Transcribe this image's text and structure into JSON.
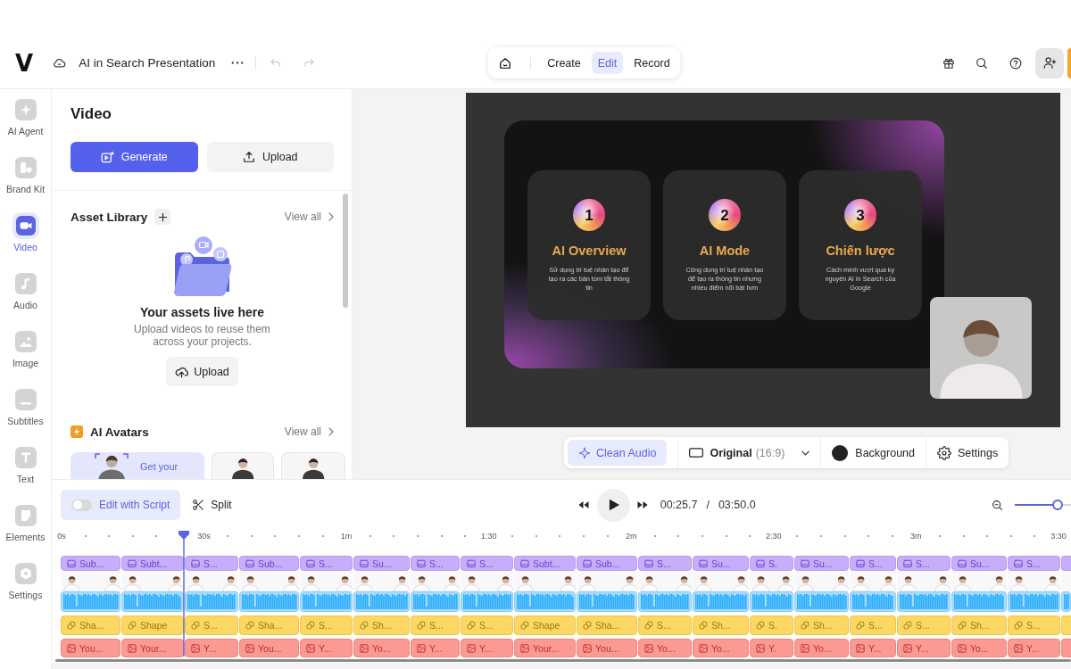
{
  "header": {
    "logo": "V",
    "project_title": "AI in Search Presentation",
    "undo": {
      "disabled": true
    },
    "redo": {
      "disabled": true
    },
    "modes": [
      {
        "label": "Create",
        "selected": false
      },
      {
        "label": "Edit",
        "selected": true
      },
      {
        "label": "Record",
        "selected": false
      }
    ]
  },
  "rail": {
    "items": [
      {
        "label": "AI Agent",
        "selected": false
      },
      {
        "label": "Brand Kit",
        "selected": false
      },
      {
        "label": "Video",
        "selected": true
      },
      {
        "label": "Audio",
        "selected": false
      },
      {
        "label": "Image",
        "selected": false
      },
      {
        "label": "Subtitles",
        "selected": false
      },
      {
        "label": "Text",
        "selected": false
      },
      {
        "label": "Elements",
        "selected": false
      },
      {
        "label": "Settings",
        "selected": false
      }
    ]
  },
  "panel": {
    "title": "Video",
    "actions": [
      {
        "label": "Generate",
        "kind": "primary"
      },
      {
        "label": "Upload",
        "kind": "secondary"
      }
    ],
    "asset_library": {
      "title": "Asset Library",
      "view_all": "View all",
      "empty_title": "Your assets live here",
      "empty_text": "Upload videos to reuse them across your projects.",
      "upload": "Upload"
    },
    "ai_avatars": {
      "title": "AI Avatars",
      "view_all": "View all",
      "cards": [
        {
          "kind": "create",
          "label": "Get your"
        },
        {
          "kind": "avatar"
        },
        {
          "kind": "avatar"
        }
      ]
    }
  },
  "preview": {
    "slide": {
      "cards": [
        {
          "number": "1",
          "title": "AI Overview",
          "text": "Sử dụng trí tuệ nhân tạo để tạo ra các bản tóm tắt thông tin"
        },
        {
          "number": "2",
          "title": "AI Mode",
          "text": "Cũng dùng trí tuệ nhân tạo để tạo ra thông tin nhưng nhiều điểm nổi bật hơn"
        },
        {
          "number": "3",
          "title": "Chiến lược",
          "text": "Cách mình vượt qua kỷ nguyên AI in Search của Google"
        }
      ]
    },
    "toolbar": {
      "clean_audio": {
        "label": "Clean Audio",
        "selected": true
      },
      "aspect": {
        "label": "Original",
        "ratio": "(16:9)"
      },
      "background": {
        "label": "Background"
      },
      "settings": {
        "label": "Settings"
      }
    }
  },
  "timeline": {
    "edit_with_script": {
      "label": "Edit with Script",
      "on": false
    },
    "split": "Split",
    "current_time": "00:25.7",
    "separator": "/",
    "total_time": "03:50.0",
    "zoom": {
      "level": 0.76
    },
    "playhead": {
      "level": 0.112
    },
    "ruler": [
      "0s",
      "30s",
      "1m",
      "1:30",
      "2m",
      "2:30",
      "3m",
      "3:30"
    ],
    "clips": [
      {
        "kind": "clip",
        "subtitle": "Sub...",
        "shape": "Sha...",
        "image": "You..."
      },
      {
        "kind": "clip",
        "subtitle": "Subt...",
        "shape": "Shape",
        "image": "Your..."
      },
      {
        "kind": "clip",
        "subtitle": "S...",
        "shape": "S...",
        "image": "Y..."
      },
      {
        "kind": "clip",
        "subtitle": "Sub...",
        "shape": "Sha...",
        "image": "You..."
      },
      {
        "kind": "clip",
        "subtitle": "S...",
        "shape": "S...",
        "image": "Y..."
      },
      {
        "kind": "clip",
        "subtitle": "Su...",
        "shape": "Sh...",
        "image": "Yo..."
      },
      {
        "kind": "clip",
        "subtitle": "S...",
        "shape": "S...",
        "image": "Y..."
      },
      {
        "kind": "clip",
        "subtitle": "S...",
        "shape": "S...",
        "image": "Y..."
      },
      {
        "kind": "clip",
        "subtitle": "Subt...",
        "shape": "Shape",
        "image": "Your..."
      },
      {
        "kind": "clip",
        "subtitle": "Sub...",
        "shape": "Sha...",
        "image": "You..."
      },
      {
        "kind": "clip",
        "subtitle": "S...",
        "shape": "S...",
        "image": "Yo..."
      },
      {
        "kind": "clip",
        "subtitle": "Su...",
        "shape": "Sh...",
        "image": "Yo..."
      },
      {
        "kind": "clip",
        "subtitle": "S.",
        "shape": "S.",
        "image": "Y."
      },
      {
        "kind": "clip",
        "subtitle": "Su...",
        "shape": "Sh...",
        "image": "Yo..."
      },
      {
        "kind": "clip",
        "subtitle": "S...",
        "shape": "S...",
        "image": "Y..."
      },
      {
        "kind": "clip",
        "subtitle": "S...",
        "shape": "S...",
        "image": "Y..."
      },
      {
        "kind": "clip",
        "subtitle": "Su...",
        "shape": "Sh...",
        "image": "Yo..."
      },
      {
        "kind": "clip",
        "subtitle": "S...",
        "shape": "S...",
        "image": "Y..."
      },
      {
        "kind": "partial"
      }
    ]
  }
}
